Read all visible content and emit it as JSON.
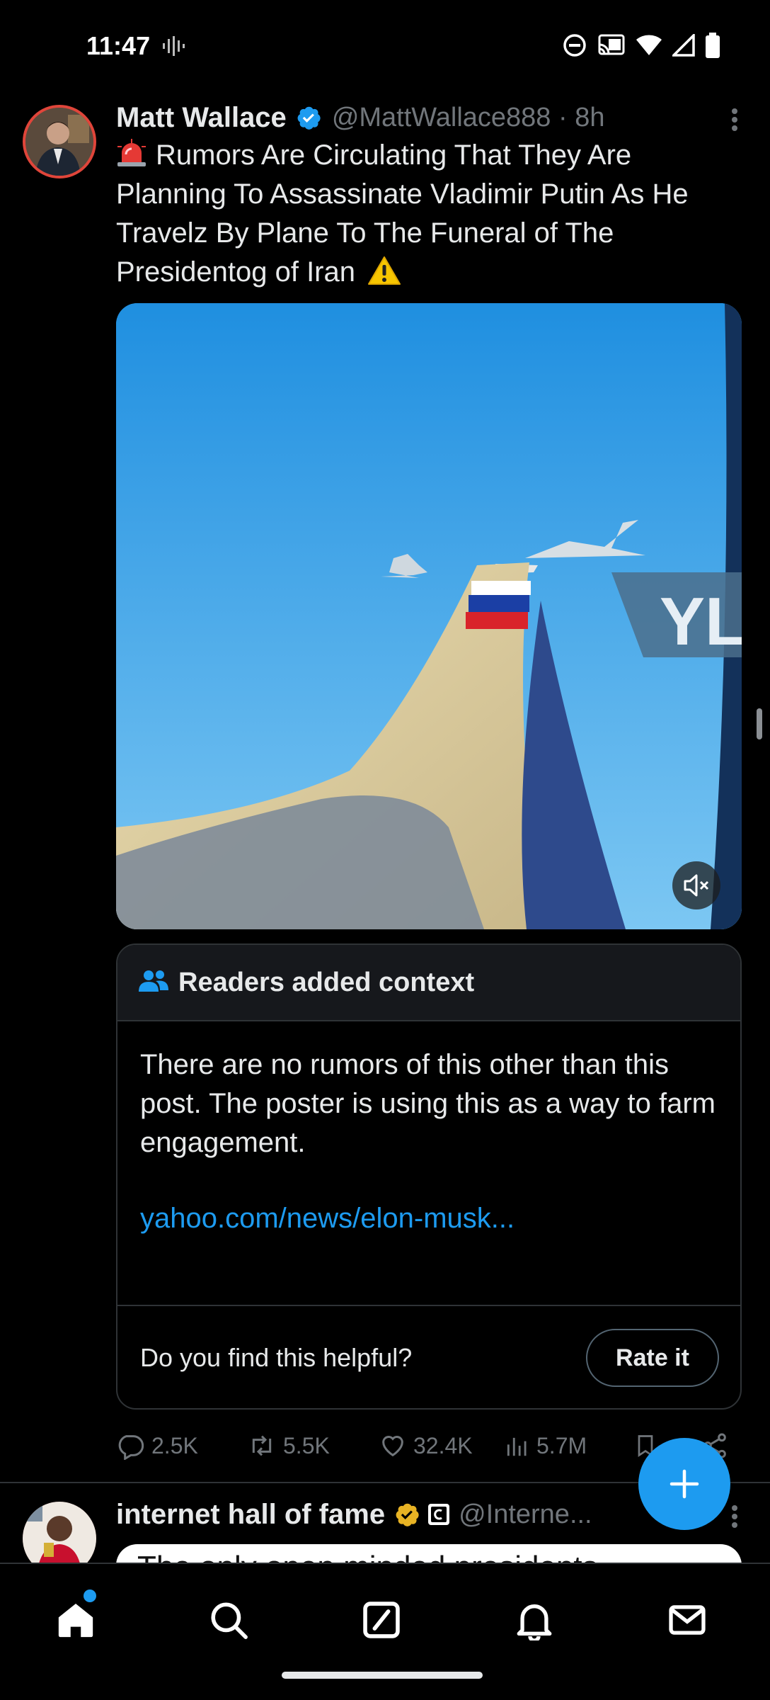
{
  "status_bar": {
    "time": "11:47",
    "icons": [
      "voice-activity-icon",
      "dnd-icon",
      "cast-icon",
      "wifi-icon",
      "signal-icon",
      "battery-icon"
    ]
  },
  "tweet": {
    "author_name": "Matt Wallace",
    "handle": "@MattWallace888",
    "time_sep": " · ",
    "time": "8h",
    "text": "Rumors Are Circulating That They Are Planning To Assassinate Vladimir Putin As He Travelz By Plane To The Funeral of The Presidentog of Iran",
    "media_watermark": "YL",
    "context": {
      "title": "Readers added context",
      "body": "There are no rumors of this other than this post. The poster is using this as a way to farm engagement.",
      "link": "yahoo.com/news/elon-musk...",
      "question": "Do you find this helpful?",
      "rate_label": "Rate it"
    },
    "stats": {
      "replies": "2.5K",
      "reposts": "5.5K",
      "likes": "32.4K",
      "views": "5.7M"
    }
  },
  "next_tweet": {
    "author_name": "internet hall of fame",
    "handle": "@Interne...",
    "media_text": "The only open minded presidents"
  },
  "colors": {
    "accent": "#1d9bf0",
    "background": "#000000",
    "muted": "#71767b",
    "verified_gold": "#e8b324"
  },
  "bottom_nav": [
    "home-icon",
    "search-icon",
    "grok-icon",
    "notifications-icon",
    "messages-icon"
  ]
}
